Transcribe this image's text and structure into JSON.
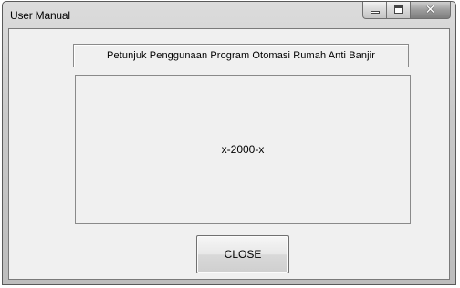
{
  "window": {
    "title": "User Manual",
    "controls": {
      "minimize_icon": "minimize-icon",
      "maximize_icon": "maximize-icon",
      "close_icon": "close-icon",
      "close_glyph": "✕"
    }
  },
  "header": {
    "text": "Petunjuk Penggunaan Program Otomasi Rumah Anti Banjir"
  },
  "display": {
    "text": "x-2000-x"
  },
  "actions": {
    "close_label": "CLOSE"
  },
  "colors": {
    "client_background": "#f0f0f0",
    "frame": "#c9c9c9"
  }
}
